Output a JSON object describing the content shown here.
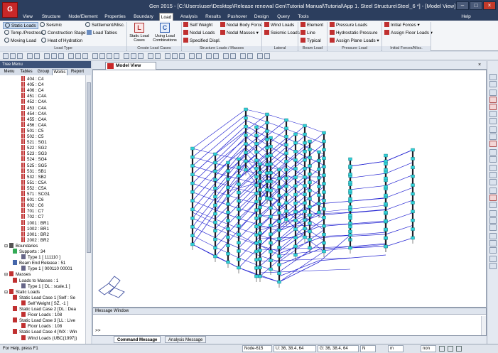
{
  "app": {
    "logo": "G",
    "title": "Gen 2015 - [C:\\Users\\user\\Desktop\\Release renewal Gen\\Tutorial Manual\\Tutorial\\App 1. Steel Structure\\Steel_6 *] - [Model View]"
  },
  "tabs": [
    "View",
    "Structure",
    "Node/Element",
    "Properties",
    "Boundary",
    "Load",
    "Analysis",
    "Results",
    "Pushover",
    "Design",
    "Query",
    "Tools"
  ],
  "help_label": "Help",
  "ribbon": {
    "load_type": {
      "static_loads": "Static Loads",
      "seismic": "Seismic",
      "settlement": "Settlement/Misc.",
      "temp": "Temp./Prestress",
      "construction": "Construction Stage",
      "load_tables": "Load Tables",
      "moving": "Moving Load",
      "hydration": "Heat of Hydration",
      "group": "Load Type"
    },
    "create": {
      "cases": "Static Load\nCases",
      "combos": "Using Load\nCombinations",
      "group": "Create Load Cases"
    },
    "structure": {
      "self_weight": "Self Weight",
      "nodal_body": "Nodal Body Force",
      "nodal_loads": "Nodal Loads",
      "nodal_masses": "Nodal Masses",
      "specified": "Specified Displ.",
      "group": "Structure Loads / Masses"
    },
    "lateral": {
      "wind": "Wind Loads",
      "seismic": "Seismic Loads",
      "group": "Lateral"
    },
    "beam": {
      "element": "Element",
      "line": "Line",
      "typical": "Typical",
      "group": "Beam Load"
    },
    "pressure": {
      "pressure": "Pressure Loads",
      "hydro": "Hydrostatic Pressure",
      "plane": "Assign Plane Loads",
      "group": "Pressure Load"
    },
    "initial": {
      "forces": "Initial Forces",
      "floor": "Assign Floor Loads",
      "group": "Initial Forces/Misc."
    }
  },
  "tree": {
    "header": "Tree Menu",
    "tabs": [
      "Menu",
      "Tables",
      "Group",
      "Works",
      "Report"
    ],
    "active_tab": "Works",
    "items": [
      {
        "label": "404 : C4",
        "indent": 2,
        "icon": "section"
      },
      {
        "label": "405 : C4",
        "indent": 2,
        "icon": "section"
      },
      {
        "label": "406 : C4",
        "indent": 2,
        "icon": "section"
      },
      {
        "label": "451 : C4A",
        "indent": 2,
        "icon": "section"
      },
      {
        "label": "452 : C4A",
        "indent": 2,
        "icon": "section"
      },
      {
        "label": "453 : C4A",
        "indent": 2,
        "icon": "section"
      },
      {
        "label": "454 : C4A",
        "indent": 2,
        "icon": "section"
      },
      {
        "label": "455 : C4A",
        "indent": 2,
        "icon": "section"
      },
      {
        "label": "456 : C4A",
        "indent": 2,
        "icon": "section"
      },
      {
        "label": "501 : C5",
        "indent": 2,
        "icon": "section"
      },
      {
        "label": "502 : C5",
        "indent": 2,
        "icon": "section"
      },
      {
        "label": "521 : SG1",
        "indent": 2,
        "icon": "section"
      },
      {
        "label": "522 : SG2",
        "indent": 2,
        "icon": "section"
      },
      {
        "label": "523 : SG3",
        "indent": 2,
        "icon": "section"
      },
      {
        "label": "524 : SG4",
        "indent": 2,
        "icon": "section"
      },
      {
        "label": "525 : SG5",
        "indent": 2,
        "icon": "section"
      },
      {
        "label": "531 : SB1",
        "indent": 2,
        "icon": "section"
      },
      {
        "label": "532 : SB2",
        "indent": 2,
        "icon": "section"
      },
      {
        "label": "551 : C5A",
        "indent": 2,
        "icon": "section"
      },
      {
        "label": "552 : C5A",
        "indent": 2,
        "icon": "section"
      },
      {
        "label": "571 : SCG1",
        "indent": 2,
        "icon": "section"
      },
      {
        "label": "601 : C6",
        "indent": 2,
        "icon": "section"
      },
      {
        "label": "602 : C6",
        "indent": 2,
        "icon": "section"
      },
      {
        "label": "701 : C7",
        "indent": 2,
        "icon": "section"
      },
      {
        "label": "702 : C7",
        "indent": 2,
        "icon": "section"
      },
      {
        "label": "1001 : BR1",
        "indent": 2,
        "icon": "section"
      },
      {
        "label": "1002 : BR1",
        "indent": 2,
        "icon": "section"
      },
      {
        "label": "2001 : BR2",
        "indent": 2,
        "icon": "section"
      },
      {
        "label": "2002 : BR2",
        "indent": 2,
        "icon": "section"
      },
      {
        "label": "Boundaries",
        "indent": 0,
        "icon": "boundary"
      },
      {
        "label": "Supports : 34",
        "indent": 1,
        "icon": "support"
      },
      {
        "label": "Type 1 [ 111110 ]",
        "indent": 2,
        "icon": "node"
      },
      {
        "label": "Beam End Release : 51",
        "indent": 1,
        "icon": "release"
      },
      {
        "label": "Type 1 [ 000110 00001",
        "indent": 2,
        "icon": "node"
      },
      {
        "label": "Masses",
        "indent": 0,
        "icon": "mass"
      },
      {
        "label": "Loads to Masses : 1",
        "indent": 1,
        "icon": "mass"
      },
      {
        "label": "Type 1 [ DL : scale.1 ]",
        "indent": 2,
        "icon": "node"
      },
      {
        "label": "Static Loads",
        "indent": 0,
        "icon": "load"
      },
      {
        "label": "Static Load Case 1 [Self : Se",
        "indent": 1,
        "icon": "load"
      },
      {
        "label": "Self Weight [ SZ, -1 ]",
        "indent": 2,
        "icon": "self"
      },
      {
        "label": "Static Load Case 2 [DL : Dea",
        "indent": 1,
        "icon": "load"
      },
      {
        "label": "Floor Loads : 108",
        "indent": 2,
        "icon": "floor"
      },
      {
        "label": "Static Load Case 3 [LL : Live",
        "indent": 1,
        "icon": "load"
      },
      {
        "label": "Floor Loads : 108",
        "indent": 2,
        "icon": "floor"
      },
      {
        "label": "Static Load Case 4 [WX : Win",
        "indent": 1,
        "icon": "load"
      },
      {
        "label": "Wind Loads (UBC(1997))",
        "indent": 2,
        "icon": "floor"
      }
    ]
  },
  "view_tab": "Model View",
  "message_window": {
    "title": "Message Window",
    "prompt": ">>"
  },
  "message_tabs": [
    "Command Message",
    "Analysis Message"
  ],
  "status": {
    "help": "For Help, press F1",
    "node": "Node-615",
    "u": "U: 36, 38.4, 64",
    "g": "G: 36, 38.4, 64",
    "unit": "N",
    "unit2": "m",
    "view": "non"
  },
  "colors": {
    "titlebar": "#2c3e5e",
    "beam": "#2424d2",
    "node": "#2fd0d8",
    "tree_icon": "#c03030"
  }
}
